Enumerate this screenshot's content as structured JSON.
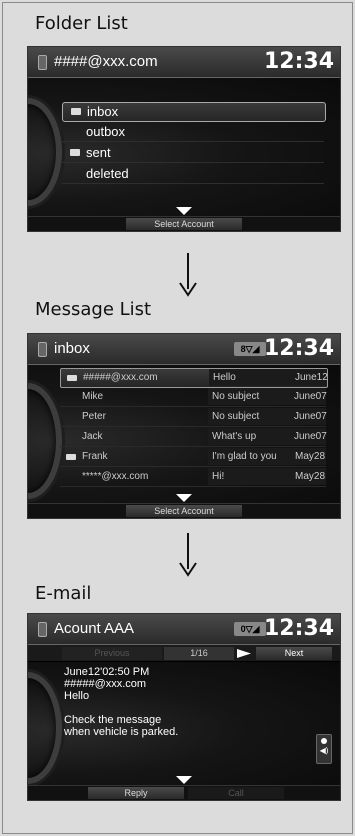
{
  "sections": {
    "folder_list": "Folder List",
    "message_list": "Message List",
    "email": "E-mail"
  },
  "clock": "12:34",
  "folder_screen": {
    "account": "####@xxx.com",
    "folders": [
      {
        "label": "inbox",
        "has_mail_icon": true,
        "selected": true
      },
      {
        "label": "outbox",
        "has_mail_icon": false,
        "selected": false
      },
      {
        "label": "sent",
        "has_mail_icon": true,
        "selected": false
      },
      {
        "label": "deleted",
        "has_mail_icon": false,
        "selected": false
      }
    ],
    "footer_button": "Select Account"
  },
  "message_screen": {
    "title": "inbox",
    "status_badge": "8▽◢",
    "messages": [
      {
        "from": "#####@xxx.com",
        "subject": "Hello",
        "date": "June12",
        "unread": true
      },
      {
        "from": "Mike",
        "subject": "No subject",
        "date": "June07",
        "unread": false
      },
      {
        "from": "Peter",
        "subject": "No subject",
        "date": "June07",
        "unread": false
      },
      {
        "from": "Jack",
        "subject": "What's up",
        "date": "June07",
        "unread": false
      },
      {
        "from": "Frank",
        "subject": "I'm glad to you",
        "date": "May28",
        "unread": true
      },
      {
        "from": "*****@xxx.com",
        "subject": "Hi!",
        "date": "May28",
        "unread": false
      }
    ],
    "footer_button": "Select Account"
  },
  "email_screen": {
    "title": "Acount AAA",
    "status_badge": "0▽◢",
    "nav": {
      "previous": "Previous",
      "page": "1/16",
      "next": "Next"
    },
    "datetime": "June12'02:50 PM",
    "from": "#####@xxx.com",
    "subject": "Hello",
    "notice_line1": "Check the message",
    "notice_line2": "when vehicle is parked.",
    "reply_button": "Reply",
    "call_button": "Call"
  }
}
